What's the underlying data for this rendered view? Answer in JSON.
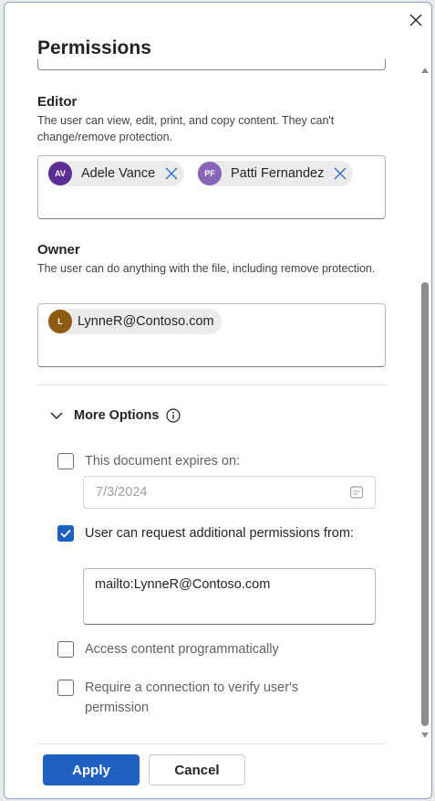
{
  "dialog": {
    "title": "Permissions",
    "close_icon": "close-icon"
  },
  "editor": {
    "label": "Editor",
    "description": "The user can view, edit, print, and copy content. They can't change/remove protection.",
    "people": [
      {
        "initials": "AV",
        "name": "Adele Vance",
        "color": "#5c2e91"
      },
      {
        "initials": "PF",
        "name": "Patti Fernandez",
        "color": "#8764b8"
      }
    ]
  },
  "owner": {
    "label": "Owner",
    "description": "The user can do anything with the file, including remove protection.",
    "people": [
      {
        "initials": "L",
        "name": "LynneR@Contoso.com",
        "color": "#8e5b12"
      }
    ]
  },
  "more_options": {
    "label": "More Options",
    "expanded": true,
    "expires": {
      "label": "This document expires on:",
      "checked": false,
      "date_value": "7/3/2024"
    },
    "request_permissions": {
      "label": "User can request additional permissions from:",
      "checked": true,
      "value": "mailto:LynneR@Contoso.com"
    },
    "programmatic": {
      "label": "Access content programmatically",
      "checked": false
    },
    "verify_connection": {
      "label": "Require a connection to verify user's permission",
      "checked": false
    }
  },
  "footer": {
    "apply_label": "Apply",
    "cancel_label": "Cancel"
  },
  "colors": {
    "accent": "#1f5fbf",
    "remove_icon": "#2f6fc8"
  }
}
